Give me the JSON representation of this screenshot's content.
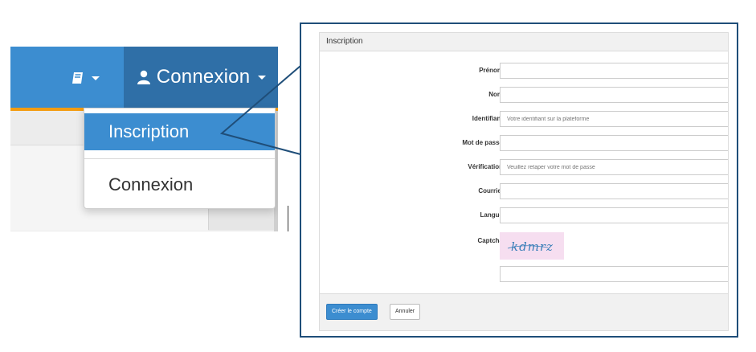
{
  "navbar": {
    "book_menu_icon": "book-icon",
    "connexion_label": "Connexion",
    "user_icon": "user-icon",
    "accent_color": "#3c8dd0",
    "active_color": "#2f6fa7",
    "underline_color": "#f39c12"
  },
  "dropdown": {
    "items": [
      {
        "label": "Inscription",
        "active": true
      },
      {
        "label": "Connexion",
        "active": false
      }
    ]
  },
  "form": {
    "title": "Inscription",
    "fields": [
      {
        "label": "Prénom",
        "value": "",
        "placeholder": ""
      },
      {
        "label": "Nom",
        "value": "",
        "placeholder": ""
      },
      {
        "label": "Identifiant",
        "value": "",
        "placeholder": "Votre identifiant sur la plateforme"
      },
      {
        "label": "Mot de passe",
        "value": "",
        "placeholder": ""
      },
      {
        "label": "Vérification",
        "value": "",
        "placeholder": "Veuillez retaper votre mot de passe"
      },
      {
        "label": "Courriel",
        "value": "",
        "placeholder": ""
      },
      {
        "label": "Langue",
        "value": "",
        "placeholder": ""
      }
    ],
    "captcha_label": "Captcha",
    "captcha_text": "kdmrz",
    "captcha_input_value": "",
    "submit_label": "Créer le compte",
    "cancel_label": "Annuler"
  }
}
